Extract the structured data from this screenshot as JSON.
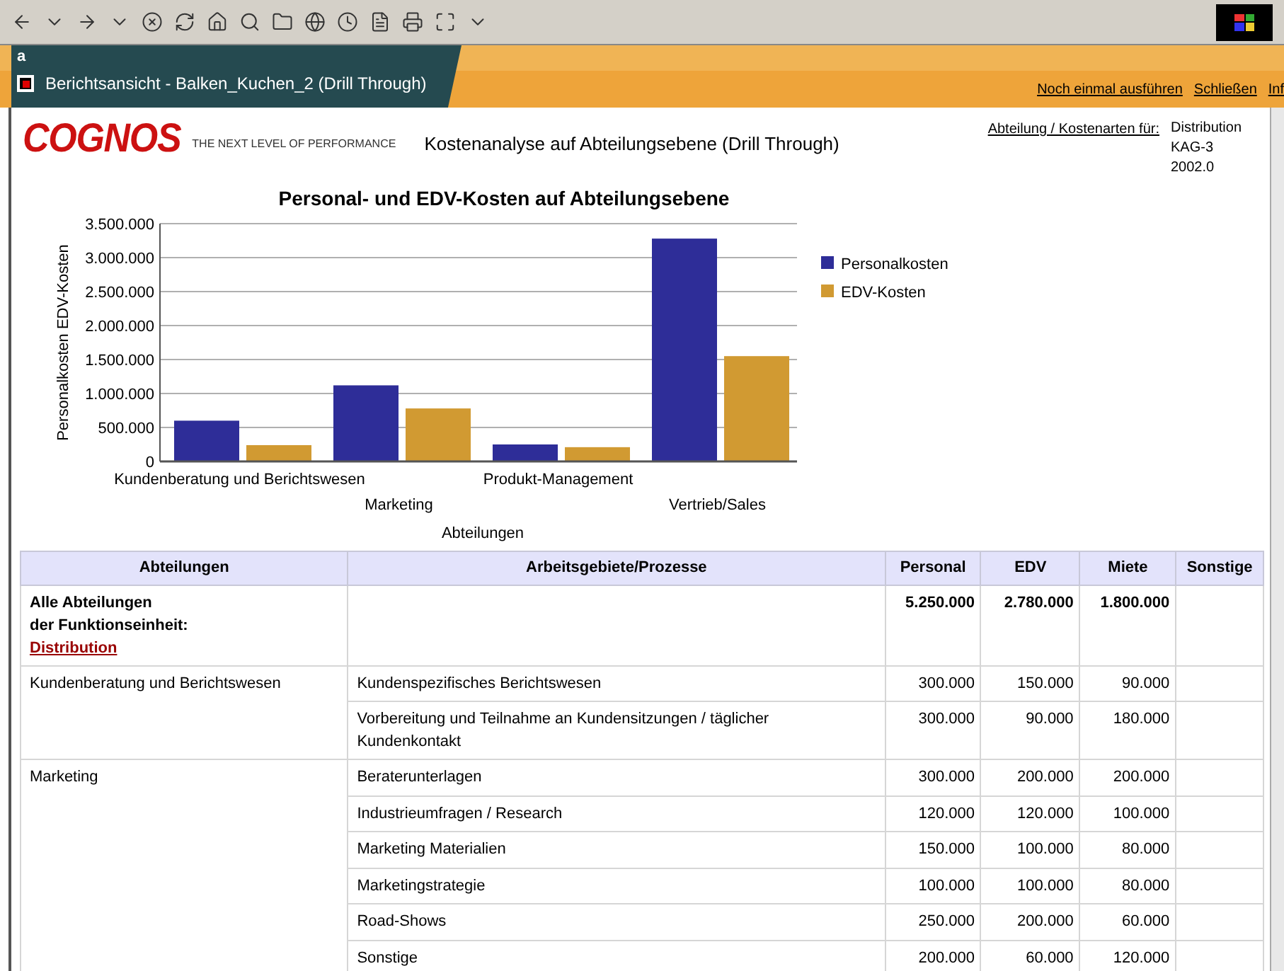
{
  "browser": {
    "tab_label": "a",
    "title": "Berichtsansicht - Balken_Kuchen_2 (Drill Through)",
    "links": [
      "Noch einmal ausführen",
      "Schließen",
      "Inf"
    ]
  },
  "report": {
    "logo": "COGNOS",
    "tagline": "THE NEXT LEVEL OF PERFORMANCE",
    "title": "Kostenanalyse auf Abteilungsebene (Drill Through)",
    "filter_label": "Abteilung / Kostenarten für:",
    "filter_values": [
      "Distribution",
      "KAG-3",
      "2002.0"
    ]
  },
  "chart": {
    "chart_data": {
      "type": "bar",
      "title": "Personal- und EDV-Kosten auf Abteilungsebene",
      "xlabel": "Abteilungen",
      "ylabel": "Personalkosten EDV-Kosten",
      "categories": [
        "Kundenberatung und Berichtswesen",
        "Marketing",
        "Produkt-Management",
        "Vertrieb/Sales"
      ],
      "series": [
        {
          "name": "Personalkosten",
          "color": "#2e2d98",
          "values": [
            600000,
            1120000,
            250000,
            3280000
          ]
        },
        {
          "name": "EDV-Kosten",
          "color": "#d19a32",
          "values": [
            240000,
            780000,
            210000,
            1550000
          ]
        }
      ],
      "ylim": [
        0,
        3500000
      ],
      "grid": true,
      "legend": true,
      "yticks": [
        {
          "value": 0,
          "label": "0"
        },
        {
          "value": 500000,
          "label": "500.000"
        },
        {
          "value": 1000000,
          "label": "1.000.000"
        },
        {
          "value": 1500000,
          "label": "1.500.000"
        },
        {
          "value": 2000000,
          "label": "2.000.000"
        },
        {
          "value": 2500000,
          "label": "2.500.000"
        },
        {
          "value": 3000000,
          "label": "3.000.000"
        },
        {
          "value": 3500000,
          "label": "3.500.000"
        }
      ]
    }
  },
  "table": {
    "columns": [
      "Abteilungen",
      "Arbeitsgebiete/Prozesse",
      "Personal",
      "EDV",
      "Miete",
      "Sonstige"
    ],
    "summary": {
      "lines": [
        "Alle Abteilungen",
        "der Funktionseinheit:"
      ],
      "link": "Distribution",
      "personal": "5.250.000",
      "edv": "2.780.000",
      "miete": "1.800.000"
    },
    "groups": [
      {
        "department": "Kundenberatung und Berichtswesen",
        "items": [
          {
            "process": "Kundenspezifisches Berichtswesen",
            "personal": "300.000",
            "edv": "150.000",
            "miete": "90.000"
          },
          {
            "process": "Vorbereitung und Teilnahme an Kundensitzungen / täglicher Kundenkontakt",
            "personal": "300.000",
            "edv": "90.000",
            "miete": "180.000"
          }
        ]
      },
      {
        "department": "Marketing",
        "items": [
          {
            "process": "Beraterunterlagen",
            "personal": "300.000",
            "edv": "200.000",
            "miete": "200.000"
          },
          {
            "process": "Industrieumfragen / Research",
            "personal": "120.000",
            "edv": "120.000",
            "miete": "100.000"
          },
          {
            "process": "Marketing Materialien",
            "personal": "150.000",
            "edv": "100.000",
            "miete": "80.000"
          },
          {
            "process": "Marketingstrategie",
            "personal": "100.000",
            "edv": "100.000",
            "miete": "80.000"
          },
          {
            "process": "Road-Shows",
            "personal": "250.000",
            "edv": "200.000",
            "miete": "60.000"
          },
          {
            "process": "Sonstige",
            "personal": "200.000",
            "edv": "60.000",
            "miete": "120.000"
          }
        ]
      }
    ]
  }
}
